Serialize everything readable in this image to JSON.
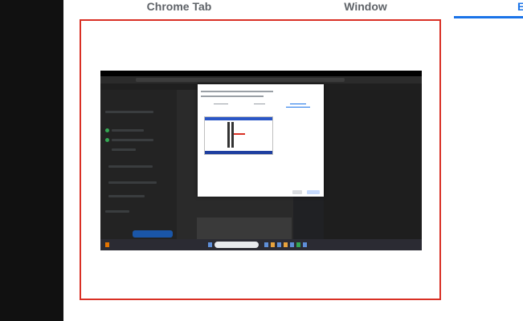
{
  "tabs": [
    {
      "label": "Chrome Tab"
    },
    {
      "label": "Window"
    },
    {
      "label": "E"
    }
  ],
  "active_tab_index": 2,
  "colors": {
    "accent": "#1a73e8",
    "frame_border": "#d93025",
    "left_panel": "#111111"
  },
  "preview": {
    "kind": "captured-screenshot"
  }
}
